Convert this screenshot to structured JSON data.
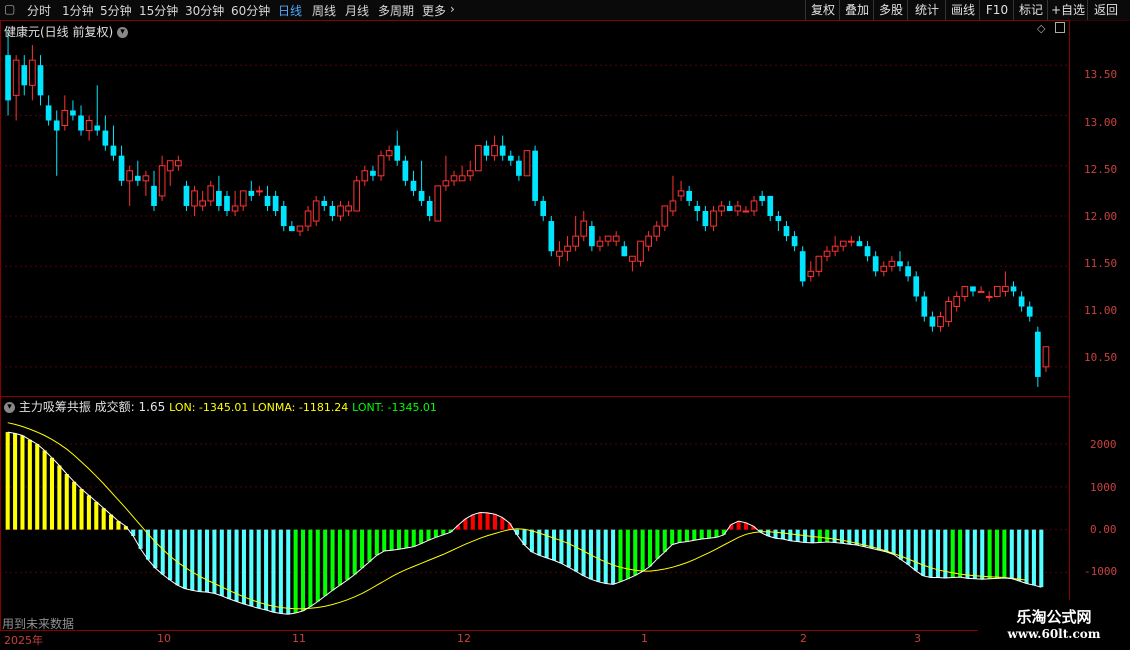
{
  "toolbar": {
    "periods": [
      "分时",
      "1分钟",
      "5分钟",
      "15分钟",
      "30分钟",
      "60分钟",
      "日线",
      "周线",
      "月线",
      "多周期",
      "更多"
    ],
    "active_period": "日线",
    "right_buttons": [
      "复权",
      "叠加",
      "多股",
      "统计",
      "画线",
      "F10",
      "标记",
      "+自选",
      "返回"
    ]
  },
  "main_chart": {
    "title": "健康元(日线 前复权)",
    "y_ticks": [
      "13.50",
      "13.00",
      "12.50",
      "12.00",
      "11.50",
      "11.00",
      "10.50"
    ]
  },
  "indicator": {
    "name": "主力吸筹共振",
    "volume_label": "成交额: 1.65",
    "lon_label": "LON: -1345.01",
    "lonma_label": "LONMA: -1181.24",
    "lont_label": "LONT: -1345.01",
    "y_ticks": [
      "2000",
      "1000",
      "0.00",
      "-1000"
    ],
    "note": "用到未来数据"
  },
  "x_axis": {
    "labels": [
      "2025年",
      "10",
      "11",
      "12",
      "1",
      "2",
      "3"
    ]
  },
  "watermark": {
    "line1": "乐淘公式网",
    "line2": "www.60lt.com"
  },
  "colors": {
    "up": "#ff3232",
    "down": "#00e5ff",
    "bar_yellow": "#ffff00",
    "bar_cyan": "#54ffff",
    "bar_green": "#00ff00",
    "bar_red": "#ff0000",
    "lonma_line": "#ffff00",
    "lon_line": "#ffffff",
    "grid": "#5a0000"
  },
  "chart_data": [
    {
      "type": "candlestick",
      "title": "健康元(日线 前复权)",
      "ylim": [
        10.25,
        13.85
      ],
      "y_ticks": [
        13.5,
        13.0,
        12.5,
        12.0,
        11.5,
        11.0,
        10.5
      ],
      "ohlc": [
        [
          13.6,
          13.85,
          13.0,
          13.15
        ],
        [
          13.2,
          13.6,
          12.95,
          13.55
        ],
        [
          13.5,
          13.6,
          13.2,
          13.3
        ],
        [
          13.3,
          13.7,
          13.15,
          13.55
        ],
        [
          13.5,
          13.6,
          13.1,
          13.2
        ],
        [
          13.1,
          13.2,
          12.9,
          12.95
        ],
        [
          12.95,
          13.05,
          12.4,
          12.85
        ],
        [
          12.9,
          13.2,
          12.85,
          13.05
        ],
        [
          13.05,
          13.15,
          12.95,
          13.0
        ],
        [
          13.0,
          13.1,
          12.8,
          12.85
        ],
        [
          12.85,
          13.0,
          12.75,
          12.95
        ],
        [
          12.9,
          13.3,
          12.8,
          12.85
        ],
        [
          12.85,
          13.0,
          12.65,
          12.7
        ],
        [
          12.7,
          12.9,
          12.55,
          12.6
        ],
        [
          12.6,
          12.7,
          12.3,
          12.35
        ],
        [
          12.35,
          12.5,
          12.1,
          12.45
        ],
        [
          12.4,
          12.55,
          12.3,
          12.35
        ],
        [
          12.35,
          12.45,
          12.2,
          12.4
        ],
        [
          12.3,
          12.45,
          12.05,
          12.1
        ],
        [
          12.2,
          12.6,
          12.15,
          12.5
        ],
        [
          12.45,
          12.55,
          12.3,
          12.55
        ],
        [
          12.5,
          12.6,
          12.45,
          12.55
        ],
        [
          12.3,
          12.35,
          12.05,
          12.1
        ],
        [
          12.1,
          12.3,
          12.0,
          12.25
        ],
        [
          12.1,
          12.25,
          12.05,
          12.15
        ],
        [
          12.15,
          12.35,
          12.1,
          12.3
        ],
        [
          12.25,
          12.4,
          12.05,
          12.1
        ],
        [
          12.2,
          12.25,
          12.0,
          12.05
        ],
        [
          12.05,
          12.25,
          12.0,
          12.1
        ],
        [
          12.1,
          12.25,
          12.05,
          12.25
        ],
        [
          12.25,
          12.35,
          12.15,
          12.2
        ],
        [
          12.25,
          12.3,
          12.2,
          12.25
        ],
        [
          12.2,
          12.3,
          12.05,
          12.1
        ],
        [
          12.2,
          12.25,
          12.0,
          12.05
        ],
        [
          12.1,
          12.15,
          11.85,
          11.9
        ],
        [
          11.9,
          11.95,
          11.85,
          11.85
        ],
        [
          11.85,
          11.9,
          11.8,
          11.9
        ],
        [
          11.9,
          12.1,
          11.85,
          12.05
        ],
        [
          11.95,
          12.2,
          11.9,
          12.15
        ],
        [
          12.15,
          12.2,
          12.05,
          12.1
        ],
        [
          12.1,
          12.15,
          11.95,
          12.0
        ],
        [
          12.0,
          12.15,
          11.95,
          12.1
        ],
        [
          12.05,
          12.15,
          12.0,
          12.1
        ],
        [
          12.05,
          12.4,
          12.05,
          12.35
        ],
        [
          12.35,
          12.5,
          12.3,
          12.45
        ],
        [
          12.45,
          12.5,
          12.35,
          12.4
        ],
        [
          12.4,
          12.65,
          12.35,
          12.6
        ],
        [
          12.6,
          12.7,
          12.55,
          12.65
        ],
        [
          12.7,
          12.85,
          12.5,
          12.55
        ],
        [
          12.55,
          12.6,
          12.3,
          12.35
        ],
        [
          12.35,
          12.45,
          12.2,
          12.25
        ],
        [
          12.25,
          12.55,
          12.1,
          12.15
        ],
        [
          12.15,
          12.2,
          11.95,
          12.0
        ],
        [
          11.95,
          12.3,
          11.95,
          12.3
        ],
        [
          12.3,
          12.6,
          12.25,
          12.35
        ],
        [
          12.35,
          12.45,
          12.3,
          12.4
        ],
        [
          12.35,
          12.5,
          12.35,
          12.4
        ],
        [
          12.4,
          12.55,
          12.35,
          12.45
        ],
        [
          12.45,
          12.7,
          12.45,
          12.7
        ],
        [
          12.7,
          12.75,
          12.55,
          12.6
        ],
        [
          12.6,
          12.8,
          12.55,
          12.7
        ],
        [
          12.7,
          12.8,
          12.55,
          12.6
        ],
        [
          12.6,
          12.65,
          12.5,
          12.55
        ],
        [
          12.55,
          12.6,
          12.35,
          12.4
        ],
        [
          12.4,
          12.65,
          12.4,
          12.65
        ],
        [
          12.65,
          12.7,
          12.1,
          12.15
        ],
        [
          12.15,
          12.2,
          11.95,
          12.0
        ],
        [
          11.95,
          12.0,
          11.6,
          11.65
        ],
        [
          11.6,
          11.75,
          11.5,
          11.65
        ],
        [
          11.65,
          11.8,
          11.55,
          11.7
        ],
        [
          11.7,
          12.0,
          11.65,
          11.8
        ],
        [
          11.8,
          12.05,
          11.75,
          11.95
        ],
        [
          11.9,
          11.95,
          11.65,
          11.7
        ],
        [
          11.7,
          11.8,
          11.65,
          11.75
        ],
        [
          11.75,
          11.8,
          11.7,
          11.8
        ],
        [
          11.75,
          11.85,
          11.7,
          11.8
        ],
        [
          11.7,
          11.75,
          11.6,
          11.6
        ],
        [
          11.55,
          11.6,
          11.45,
          11.6
        ],
        [
          11.55,
          11.75,
          11.5,
          11.75
        ],
        [
          11.7,
          11.85,
          11.65,
          11.8
        ],
        [
          11.8,
          11.95,
          11.75,
          11.9
        ],
        [
          11.9,
          12.1,
          11.85,
          12.1
        ],
        [
          12.05,
          12.4,
          12.0,
          12.15
        ],
        [
          12.2,
          12.35,
          12.15,
          12.25
        ],
        [
          12.25,
          12.3,
          12.1,
          12.15
        ],
        [
          12.1,
          12.15,
          11.95,
          12.05
        ],
        [
          12.05,
          12.1,
          11.85,
          11.9
        ],
        [
          11.9,
          12.1,
          11.85,
          12.05
        ],
        [
          12.05,
          12.15,
          12.0,
          12.1
        ],
        [
          12.1,
          12.15,
          12.05,
          12.05
        ],
        [
          12.05,
          12.15,
          12.0,
          12.1
        ],
        [
          12.05,
          12.1,
          12.05,
          12.05
        ],
        [
          12.05,
          12.2,
          12.0,
          12.15
        ],
        [
          12.2,
          12.25,
          12.1,
          12.15
        ],
        [
          12.2,
          12.2,
          11.95,
          12.0
        ],
        [
          12.0,
          12.05,
          11.85,
          11.95
        ],
        [
          11.9,
          11.95,
          11.75,
          11.8
        ],
        [
          11.8,
          11.85,
          11.65,
          11.7
        ],
        [
          11.65,
          11.7,
          11.3,
          11.35
        ],
        [
          11.4,
          11.55,
          11.35,
          11.45
        ],
        [
          11.45,
          11.6,
          11.4,
          11.6
        ],
        [
          11.6,
          11.7,
          11.55,
          11.65
        ],
        [
          11.65,
          11.8,
          11.6,
          11.7
        ],
        [
          11.7,
          11.75,
          11.65,
          11.75
        ],
        [
          11.75,
          11.8,
          11.7,
          11.75
        ],
        [
          11.75,
          11.8,
          11.7,
          11.7
        ],
        [
          11.7,
          11.75,
          11.55,
          11.6
        ],
        [
          11.6,
          11.65,
          11.4,
          11.45
        ],
        [
          11.45,
          11.55,
          11.4,
          11.5
        ],
        [
          11.5,
          11.6,
          11.45,
          11.55
        ],
        [
          11.55,
          11.65,
          11.45,
          11.5
        ],
        [
          11.5,
          11.55,
          11.35,
          11.4
        ],
        [
          11.4,
          11.45,
          11.15,
          11.2
        ],
        [
          11.2,
          11.25,
          10.95,
          11.0
        ],
        [
          11.0,
          11.05,
          10.85,
          10.9
        ],
        [
          10.9,
          11.05,
          10.85,
          11.0
        ],
        [
          10.95,
          11.2,
          10.9,
          11.15
        ],
        [
          11.1,
          11.25,
          11.05,
          11.2
        ],
        [
          11.2,
          11.3,
          11.15,
          11.3
        ],
        [
          11.3,
          11.3,
          11.2,
          11.25
        ],
        [
          11.25,
          11.3,
          11.25,
          11.25
        ],
        [
          11.2,
          11.25,
          11.15,
          11.2
        ],
        [
          11.2,
          11.3,
          11.2,
          11.3
        ],
        [
          11.25,
          11.45,
          11.2,
          11.3
        ],
        [
          11.3,
          11.35,
          11.2,
          11.25
        ],
        [
          11.2,
          11.25,
          11.05,
          11.1
        ],
        [
          11.1,
          11.15,
          10.95,
          11.0
        ],
        [
          10.85,
          10.9,
          10.3,
          10.4
        ],
        [
          10.5,
          10.7,
          10.45,
          10.7
        ]
      ]
    },
    {
      "type": "bar",
      "title": "主力吸筹共振",
      "ylim": [
        -2300,
        2750
      ],
      "y_ticks": [
        2000,
        1000,
        0,
        -1000
      ],
      "series": [
        {
          "name": "LON",
          "values": [
            2280,
            2250,
            2200,
            2100,
            2000,
            1850,
            1680,
            1500,
            1300,
            1120,
            950,
            800,
            650,
            500,
            350,
            200,
            80,
            -150,
            -450,
            -700,
            -900,
            -1050,
            -1180,
            -1300,
            -1380,
            -1420,
            -1450,
            -1460,
            -1490,
            -1550,
            -1620,
            -1680,
            -1740,
            -1790,
            -1840,
            -1880,
            -1930,
            -1960,
            -1980,
            -1950,
            -1900,
            -1800,
            -1680,
            -1550,
            -1420,
            -1300,
            -1180,
            -1050,
            -900,
            -750,
            -600,
            -500,
            -480,
            -460,
            -430,
            -400,
            -330,
            -250,
            -180,
            -120,
            -60,
            100,
            250,
            350,
            400,
            390,
            360,
            280,
            150,
            -120,
            -360,
            -520,
            -600,
            -660,
            -720,
            -790,
            -880,
            -980,
            -1080,
            -1160,
            -1220,
            -1260,
            -1280,
            -1220,
            -1150,
            -1070,
            -980,
            -860,
            -680,
            -520,
            -350,
            -300,
            -280,
            -250,
            -220,
            -200,
            -180,
            -120,
            120,
            200,
            160,
            80,
            -70,
            -150,
            -200,
            -220,
            -260,
            -280,
            -300,
            -310,
            -300,
            -290,
            -300,
            -320,
            -340,
            -360,
            -400,
            -440,
            -480,
            -520,
            -580,
            -700,
            -820,
            -960,
            -1080,
            -1120,
            -1120,
            -1130,
            -1120,
            -1110,
            -1140,
            -1150,
            -1160,
            -1150,
            -1140,
            -1130,
            -1145,
            -1200,
            -1260,
            -1300,
            -1345
          ]
        },
        {
          "name": "LONMA",
          "values": [
            2500,
            2460,
            2410,
            2350,
            2280,
            2200,
            2110,
            2000,
            1880,
            1740,
            1580,
            1420,
            1250,
            1070,
            880,
            690,
            500,
            300,
            100,
            -100,
            -290,
            -460,
            -620,
            -760,
            -880,
            -990,
            -1090,
            -1180,
            -1260,
            -1340,
            -1420,
            -1500,
            -1570,
            -1640,
            -1700,
            -1750,
            -1790,
            -1820,
            -1840,
            -1850,
            -1850,
            -1840,
            -1820,
            -1790,
            -1750,
            -1700,
            -1640,
            -1570,
            -1490,
            -1400,
            -1300,
            -1200,
            -1100,
            -1010,
            -930,
            -860,
            -790,
            -720,
            -650,
            -580,
            -500,
            -420,
            -340,
            -270,
            -200,
            -140,
            -90,
            -40,
            0,
            20,
            10,
            -30,
            -80,
            -140,
            -200,
            -260,
            -330,
            -410,
            -500,
            -590,
            -680,
            -760,
            -830,
            -880,
            -920,
            -950,
            -970,
            -970,
            -950,
            -920,
            -880,
            -830,
            -770,
            -700,
            -620,
            -540,
            -450,
            -360,
            -270,
            -180,
            -110,
            -70,
            -50,
            -50,
            -60,
            -80,
            -100,
            -120,
            -140,
            -160,
            -180,
            -200,
            -220,
            -250,
            -280,
            -320,
            -360,
            -400,
            -450,
            -500,
            -560,
            -620,
            -690,
            -760,
            -830,
            -890,
            -940,
            -980,
            -1010,
            -1040,
            -1060,
            -1080,
            -1090,
            -1100,
            -1110,
            -1120,
            -1140,
            -1160,
            -1181
          ]
        }
      ]
    }
  ]
}
